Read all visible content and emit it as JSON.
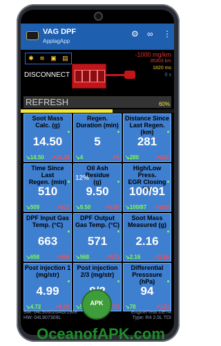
{
  "app": {
    "title": "VAG DPF",
    "subtitle": "ApplagApp"
  },
  "status": {
    "disconnect_label": "DISCONNECT",
    "refresh_label": "REFRESH",
    "progress_percent": 60,
    "progress_label": "60%",
    "metrics": [
      "-1000 mg/km",
      "35303 km",
      "1820 ms",
      "0 s"
    ]
  },
  "tiles": [
    {
      "label": "Soot Mass\nCalc. (g)",
      "value": "14.50",
      "min": "↘14.50",
      "max": "↗15.38"
    },
    {
      "label": "Regen.\nDuration (min)",
      "value": "5",
      "min": "↘4",
      "max": "↗5"
    },
    {
      "label": "Distance Since\nLast Regen. (km)",
      "value": "281",
      "min": "↘280",
      "max": "↗281"
    },
    {
      "label": "Time Since Last\nRegen. (min)",
      "value": "510",
      "min": "↘509",
      "max": "↗510"
    },
    {
      "label": "Oil Ash Residue\n(g)",
      "value": "9.50",
      "min": "↘9.50",
      "max": "↗9.50",
      "overlay": "12%"
    },
    {
      "label": "High/Low Press.\nEGR Closing (%)",
      "value": "100/91",
      "min": "↘100/87",
      "max": "↗100/"
    },
    {
      "label": "DPF Input Gas\nTemp. (°C)",
      "value": "663",
      "min": "↘658",
      "max": "↗666"
    },
    {
      "label": "DPF Output\nGas Temp. (°C)",
      "value": "571",
      "min": "↘568",
      "max": "↗571"
    },
    {
      "label": "Soot Mass\nMeasured (g)",
      "value": "2.16",
      "min": "↘2.16",
      "max": "↗2.16"
    },
    {
      "label": "Post injection 1\n(mg/str)",
      "value": "4.99",
      "min": "↘4.72",
      "max": "↗5.00"
    },
    {
      "label": "Post injection\n2/3 (mg/str)",
      "value": "8/2",
      "min": "↘5.00",
      "max": "↗7/2"
    },
    {
      "label": "Differential\nPresssure (hPa)",
      "value": "94",
      "min": "↘78",
      "max": "↗103"
    }
  ],
  "footer": {
    "sw": "SW: 04L906026AG/1969",
    "hw": "HW: 04L907309L",
    "engine": "Engine/Year:DETA",
    "type": "Type: R4 2.0L TDI"
  },
  "watermark": {
    "text": "OceanofAPK.com",
    "logo_text": "APK"
  },
  "colors": {
    "appbar": "#1f5fb0",
    "tile": "#3f7fd0",
    "progress": "#f3e63a"
  }
}
